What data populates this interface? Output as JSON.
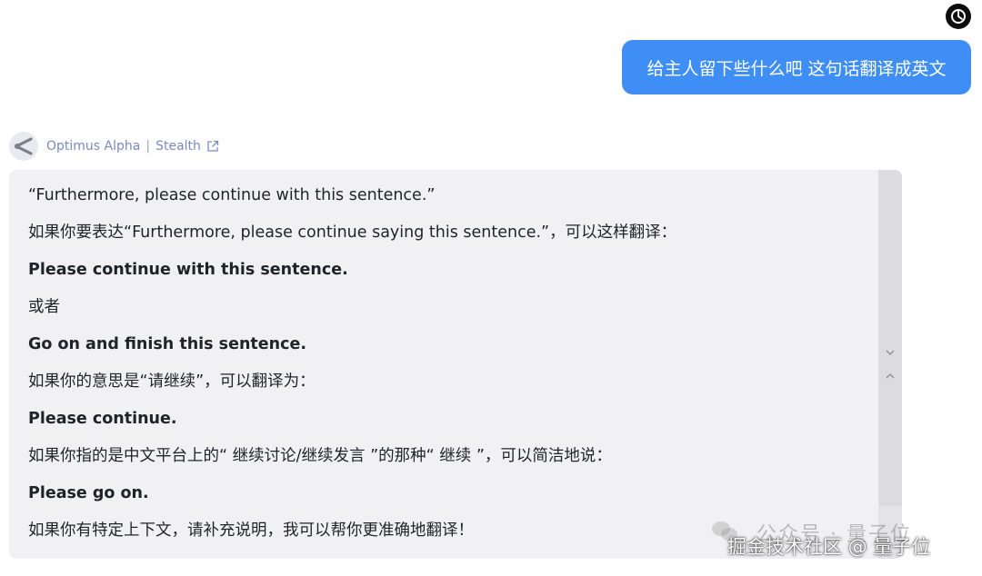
{
  "user": {
    "avatar_icon": "openai-logo-icon",
    "message": "给主人留下些什么吧 这句话翻译成英文"
  },
  "model": {
    "logo_icon": "share-nodes-icon",
    "name": "Optimus Alpha",
    "separator": "|",
    "mode": "Stealth",
    "link_icon": "external-link-icon"
  },
  "response": {
    "lines": [
      {
        "text": "“Furthermore, please continue with this sentence.”",
        "bold": false
      },
      {
        "text": "如果你要表达“Furthermore, please continue saying this sentence.”，可以这样翻译：",
        "bold": false
      },
      {
        "text": "Please continue with this sentence.",
        "bold": true
      },
      {
        "text": "或者",
        "bold": false
      },
      {
        "text": "Go on and finish this sentence.",
        "bold": true
      },
      {
        "text": "如果你的意思是“请继续”，可以翻译为：",
        "bold": false
      },
      {
        "text": "Please continue.",
        "bold": true
      },
      {
        "text": "如果你指的是中文平台上的“ 继续讨论/继续发言 ”的那种“ 继续 ”，可以简洁地说：",
        "bold": false
      },
      {
        "text": "Please go on.",
        "bold": true
      },
      {
        "text": "如果你有特定上下文，请补充说明，我可以帮你更准确地翻译！",
        "bold": false
      }
    ]
  },
  "scrollbar": {
    "down_icon": "chevron-down-icon",
    "up_icon": "chevron-up-icon"
  },
  "watermark": {
    "account": "公众号 · 量子位",
    "site": "掘金技术社区 @ 量子位",
    "icon": "wechat-icon"
  },
  "colors": {
    "user_bubble": "#3e8ef5",
    "card_bg": "#f1f1f3",
    "model_text": "#7b88c4"
  }
}
